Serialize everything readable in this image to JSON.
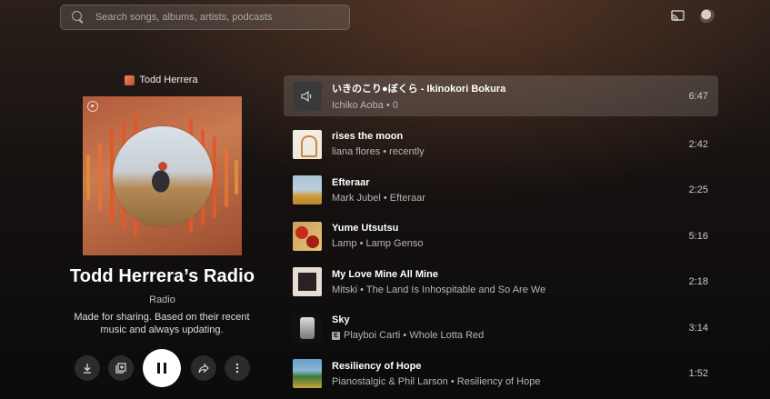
{
  "search": {
    "placeholder": "Search songs, albums, artists, podcasts"
  },
  "header_icons": [
    "cast-icon",
    "account-avatar"
  ],
  "playlist": {
    "owner": "Todd Herrera",
    "title": "Todd Herrera’s Radio",
    "type": "Radio",
    "description": "Made for sharing. Based on their recent music and always updating."
  },
  "actions": [
    "download-icon",
    "save-to-library-icon",
    "pause-icon",
    "share-icon",
    "more-icon"
  ],
  "queue": [
    {
      "title": "いきのこり●ぼくら - Ikinokori Bokura",
      "subtitle": "Ichiko Aoba • 0",
      "duration": "6:47",
      "active": true,
      "explicit": false
    },
    {
      "title": "rises the moon",
      "subtitle": "liana flores • recently",
      "duration": "2:42",
      "active": false,
      "explicit": false
    },
    {
      "title": "Efteraar",
      "subtitle": "Mark Jubel • Efteraar",
      "duration": "2:25",
      "active": false,
      "explicit": false
    },
    {
      "title": "Yume Utsutsu",
      "subtitle": "Lamp • Lamp Genso",
      "duration": "5:16",
      "active": false,
      "explicit": false
    },
    {
      "title": "My Love Mine All Mine",
      "subtitle": "Mitski • The Land Is Inhospitable and So Are We",
      "duration": "2:18",
      "active": false,
      "explicit": false
    },
    {
      "title": "Sky",
      "subtitle": "Playboi Carti • Whole Lotta Red",
      "duration": "3:14",
      "active": false,
      "explicit": true,
      "explicit_badge": "E"
    },
    {
      "title": "Resiliency of Hope",
      "subtitle": "Pianostalgic & Phil Larson • Resiliency of Hope",
      "duration": "1:52",
      "active": false,
      "explicit": false
    }
  ]
}
